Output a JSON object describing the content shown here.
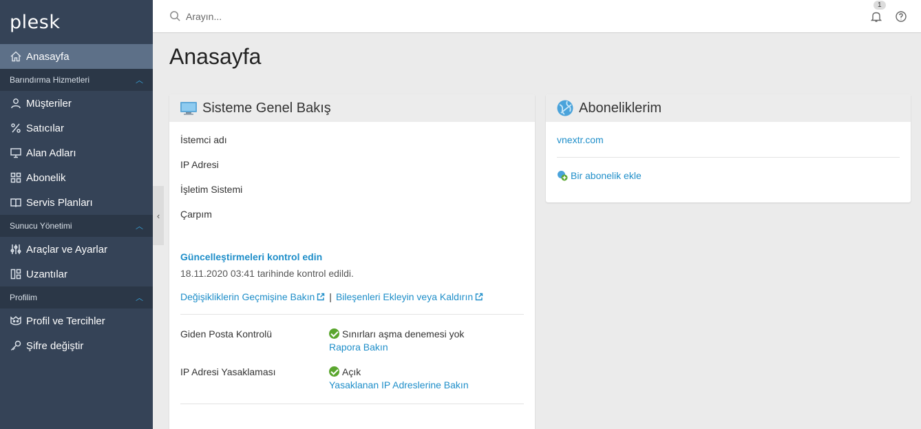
{
  "app": {
    "logo": "plesk"
  },
  "search": {
    "placeholder": "Arayın..."
  },
  "notifications": {
    "count": "1"
  },
  "sidebar": {
    "home": "Anasayfa",
    "sections": [
      {
        "title": "Barındırma Hizmetleri",
        "items": [
          "Müşteriler",
          "Satıcılar",
          "Alan Adları",
          "Abonelik",
          "Servis Planları"
        ]
      },
      {
        "title": "Sunucu Yönetimi",
        "items": [
          "Araçlar ve Ayarlar",
          "Uzantılar"
        ]
      },
      {
        "title": "Profilim",
        "items": [
          "Profil ve Tercihler",
          "Şifre değiştir"
        ]
      }
    ]
  },
  "page": {
    "title": "Anasayfa"
  },
  "overview": {
    "title": "Sisteme Genel Bakış",
    "fields": [
      "İstemci adı",
      "IP Adresi",
      "İşletim Sistemi",
      "Çarpım"
    ],
    "update_link": "Güncelleştirmeleri kontrol edin",
    "update_note": "18.11.2020 03:41 tarihinde kontrol edildi.",
    "history_link": "Değişikliklerin Geçmişine Bakın",
    "separator": "|",
    "components_link": "Bileşenleri Ekleyin veya Kaldırın",
    "mail_label": "Giden Posta Kontrolü",
    "mail_status": "Sınırları aşma denemesi yok",
    "mail_link": "Rapora Bakın",
    "ipban_label": "IP Adresi Yasaklaması",
    "ipban_status": "Açık",
    "ipban_link": "Yasaklanan IP Adreslerine Bakın"
  },
  "subscriptions": {
    "title": "Aboneliklerim",
    "domain": "vnextr.com",
    "add_link": "Bir abonelik ekle"
  },
  "colors": {
    "sidebar": "#354357",
    "active": "#5d7088",
    "link": "#1e8ec9",
    "ok": "#5aa62e"
  }
}
